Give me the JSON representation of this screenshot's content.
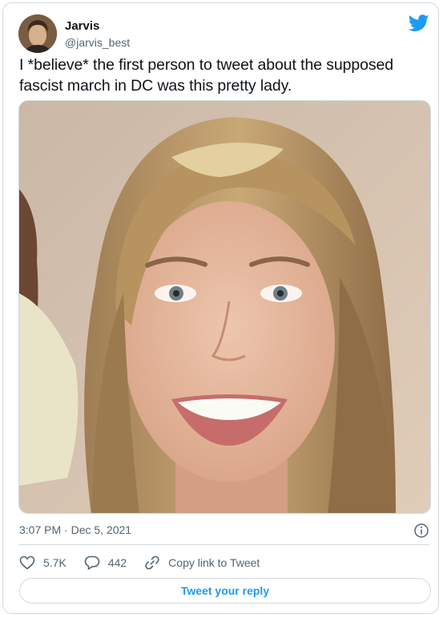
{
  "author": {
    "name": "Jarvis",
    "handle": "@jarvis_best"
  },
  "tweet": {
    "text_line1": "I *believe* the first person to tweet about the supposed",
    "text_line2": "fascist march in DC was this pretty lady.",
    "timestamp": "3:07 PM · Dec 5, 2021"
  },
  "metrics": {
    "likes": "5.7K",
    "replies": "442",
    "copy_link": "Copy link to Tweet"
  },
  "reply_button": "Tweet your reply",
  "icons": [
    "twitter-bird-icon",
    "info-icon",
    "heart-icon",
    "reply-bubble-icon",
    "link-icon"
  ],
  "colors": {
    "brand": "#1d9bf0",
    "text": "#0f1419",
    "secondary": "#536471",
    "border": "#cfd9de"
  }
}
